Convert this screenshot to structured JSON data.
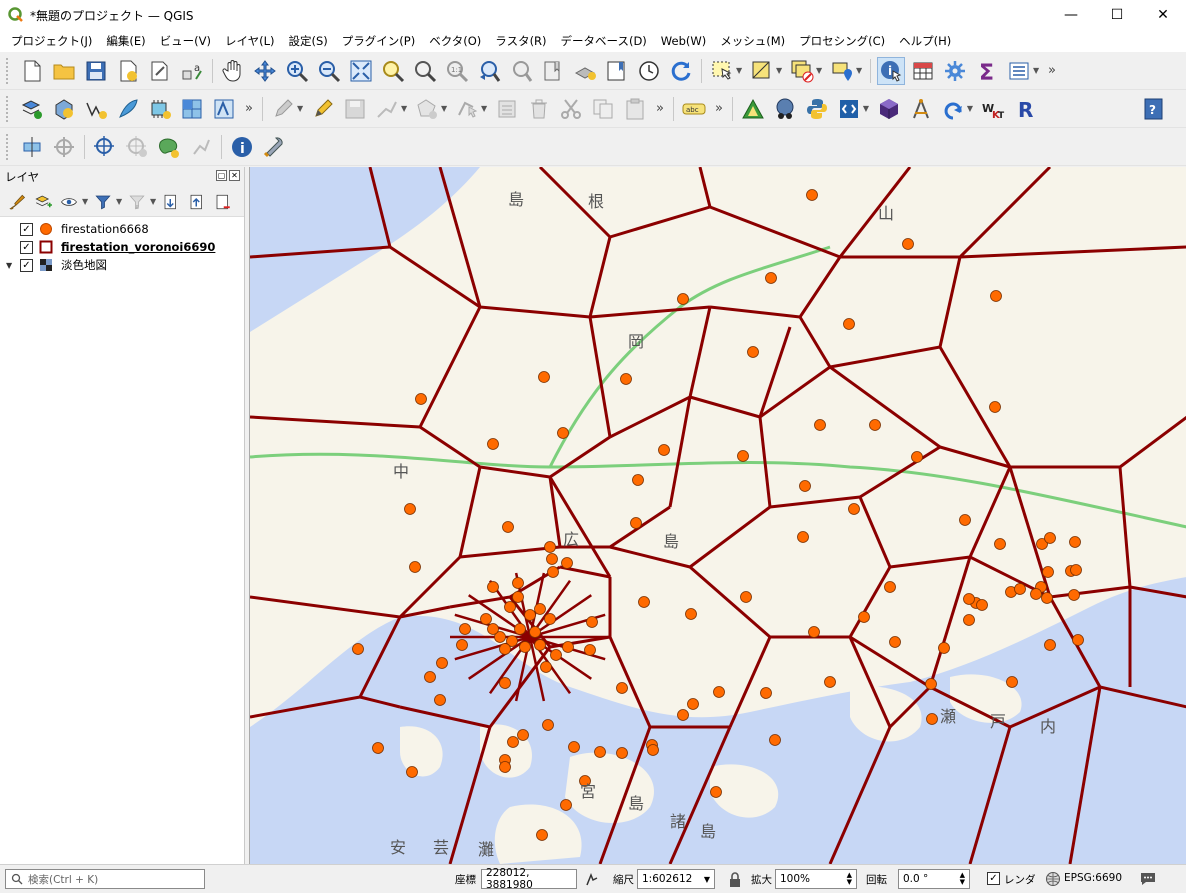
{
  "window": {
    "title": "*無題のプロジェクト — QGIS",
    "minimize": "—",
    "maximize": "☐",
    "close": "✕"
  },
  "menu": [
    "プロジェクト(J)",
    "編集(E)",
    "ビュー(V)",
    "レイヤ(L)",
    "設定(S)",
    "プラグイン(P)",
    "ベクタ(O)",
    "ラスタ(R)",
    "データベース(D)",
    "Web(W)",
    "メッシュ(M)",
    "プロセシング(C)",
    "ヘルプ(H)"
  ],
  "toolbar": {
    "more": "»",
    "labeling_badge": "abc",
    "wkt_label": "WKT",
    "r_label": "R",
    "sigma": "Σ"
  },
  "layers_panel": {
    "title": "レイヤ",
    "layers": [
      {
        "name": "firestation6668",
        "visible": true,
        "symbol": "orange-point"
      },
      {
        "name": "firestation_voronoi6690",
        "visible": true,
        "symbol": "dark-red-polygon"
      },
      {
        "name": "淡色地図",
        "visible": true,
        "symbol": "raster-tile"
      }
    ]
  },
  "map": {
    "labels": [
      "島",
      "根",
      "山",
      "岡",
      "広",
      "島",
      "中",
      "瀬",
      "戸",
      "内",
      "安",
      "芸",
      "灘",
      "宮",
      "島",
      "諸",
      "島"
    ]
  },
  "status": {
    "search_placeholder": "検索(Ctrl + K)",
    "coord_label": "座標",
    "coord_value": "228012, 3881980",
    "scale_label": "縮尺",
    "scale_value": "1:602612",
    "magnifier_label": "拡大",
    "magnifier_value": "100%",
    "rotation_label": "回転",
    "rotation_value": "0.0 °",
    "render_label": "レンダ",
    "crs": "EPSG:6690"
  },
  "colors": {
    "point_fill": "#ff6a00",
    "polygon_stroke": "#8b0000",
    "sea": "#c7d7f5",
    "land": "#f7f4ea"
  }
}
